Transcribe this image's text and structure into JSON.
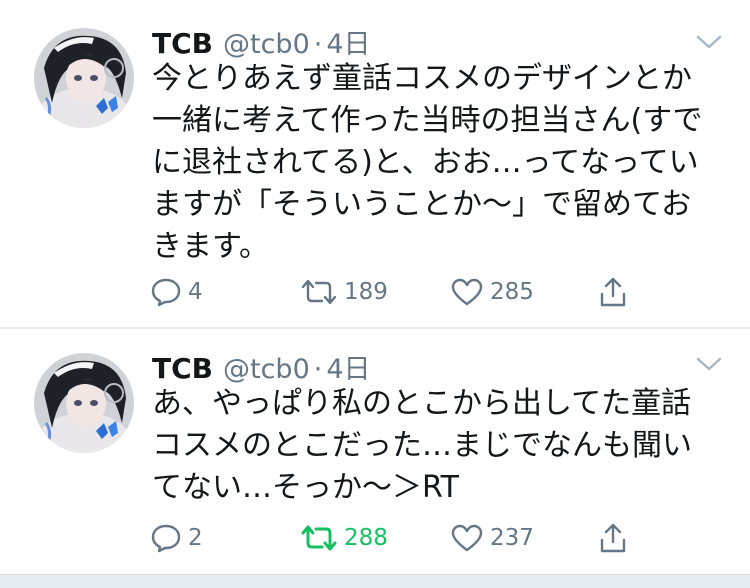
{
  "tweets": [
    {
      "name": "TCB",
      "handle": "@tcb0",
      "sep": "·",
      "time": "4日",
      "text": "今とりあえず童話コスメのデザインとか一緒に考えて作った当時の担当さん(すでに退社されてる)と、おお…ってなっていますが「そういうことか〜」で留めておきます。",
      "reply_count": "4",
      "retweet_count": "189",
      "like_count": "285",
      "retweeted": false
    },
    {
      "name": "TCB",
      "handle": "@tcb0",
      "sep": "·",
      "time": "4日",
      "text": "あ、やっぱり私のとこから出してた童話コスメのとこだった…まじでなんも聞いてない…そっか〜＞RT",
      "reply_count": "2",
      "retweet_count": "288",
      "like_count": "237",
      "retweeted": true
    }
  ],
  "colors": {
    "text": "#14171a",
    "secondary": "#657786",
    "retweet_active": "#17bf63",
    "separator": "#e6ecf0"
  },
  "icons": [
    "reply-icon",
    "retweet-icon",
    "like-icon",
    "share-icon",
    "chevron-down-icon"
  ]
}
